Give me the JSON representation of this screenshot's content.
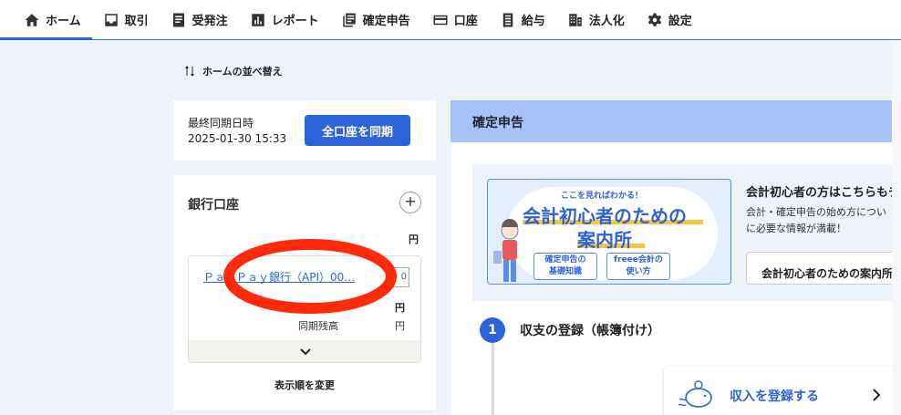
{
  "nav": {
    "items": [
      {
        "label": "ホーム",
        "icon": "home-icon",
        "active": true
      },
      {
        "label": "取引",
        "icon": "inbox-icon",
        "active": false
      },
      {
        "label": "受発注",
        "icon": "document-icon",
        "active": false
      },
      {
        "label": "レポート",
        "icon": "bar-chart-icon",
        "active": false
      },
      {
        "label": "確定申告",
        "icon": "tax-document-icon",
        "active": false
      },
      {
        "label": "口座",
        "icon": "credit-card-icon",
        "active": false
      },
      {
        "label": "給与",
        "icon": "payroll-icon",
        "active": false
      },
      {
        "label": "法人化",
        "icon": "building-icon",
        "active": false
      },
      {
        "label": "設定",
        "icon": "gear-icon",
        "active": false
      }
    ]
  },
  "home": {
    "sort_label": "ホームの並べ替え"
  },
  "sync": {
    "label": "最終同期日時",
    "time": "2025-01-30 15:33",
    "button": "全口座を同期"
  },
  "bank": {
    "title": "銀行口座",
    "add": "+",
    "yen_header": "円",
    "account_name": "ＰａｙＰａｙ銀行（API）00…",
    "amount_value": "0",
    "balance_yen": "円",
    "sync_balance_label": "同期残高",
    "sync_balance_yen": "円",
    "reorder": "表示順を変更"
  },
  "tax": {
    "header": "確定申告",
    "banner": {
      "tag": "ここを見ればわかる！",
      "line1": "会計初心者のための",
      "line2": "案内所",
      "chip1_line1": "確定申告の",
      "chip1_line2": "基礎知識",
      "chip2_line1": "freee会計の",
      "chip2_line2": "使い方"
    },
    "guide_title": "会計初心者の方はこちらもチ",
    "guide_desc1": "会計・確定申告の始め方につい",
    "guide_desc2": "に必要な情報が満載！",
    "guide_button": "会計初心者のための案内所",
    "step_number": "1",
    "step_title": "収支の登録（帳簿付け）",
    "income_button": "収入を登録する"
  },
  "colors": {
    "accent": "#2d63d8",
    "annotation": "#ff2a0c",
    "tax_header_bg": "#a7c3f5"
  }
}
